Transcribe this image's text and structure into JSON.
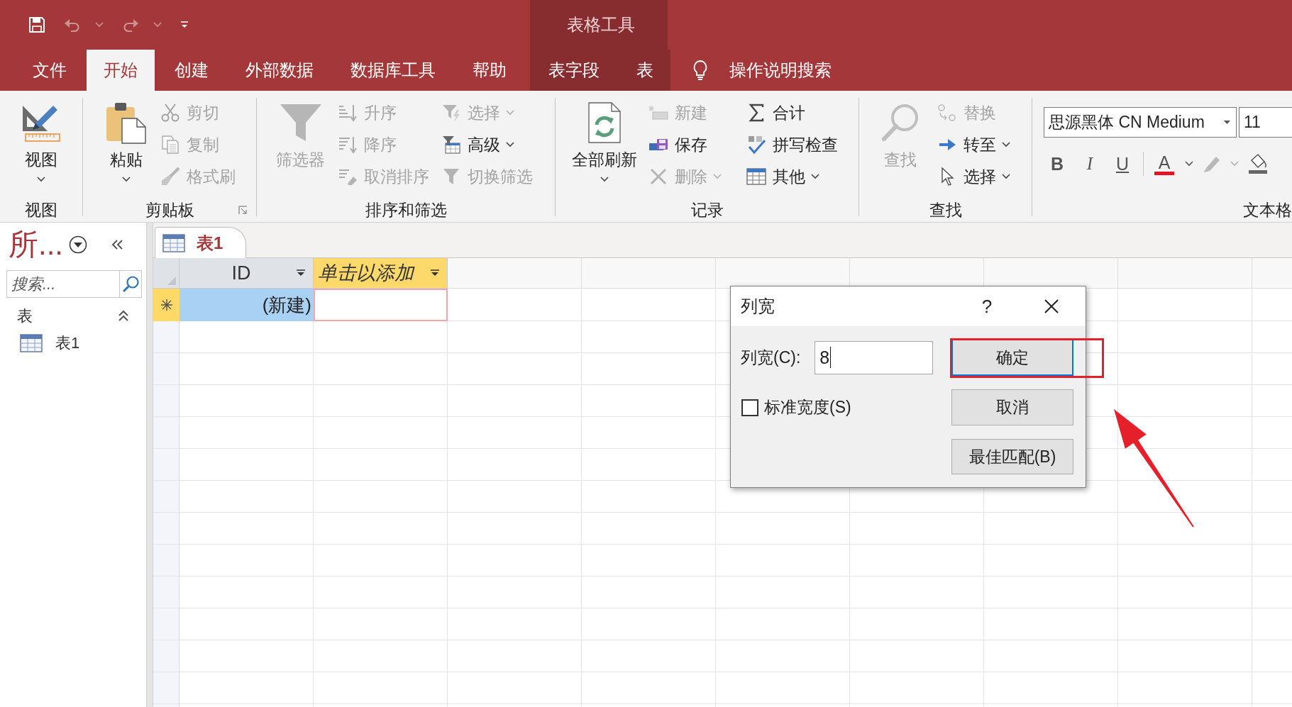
{
  "quick_access": [
    {
      "kind": "save",
      "disabled": false,
      "dropdown": false
    },
    {
      "kind": "undo",
      "disabled": true,
      "dropdown": true
    },
    {
      "kind": "redo",
      "disabled": true,
      "dropdown": true
    },
    {
      "kind": "customize",
      "disabled": false,
      "dropdown": false
    }
  ],
  "context_title": "表格工具",
  "ribbon_tabs": [
    {
      "label": "文件",
      "selected": false,
      "context": false
    },
    {
      "label": "开始",
      "selected": true,
      "context": false
    },
    {
      "label": "创建",
      "selected": false,
      "context": false
    },
    {
      "label": "外部数据",
      "selected": false,
      "context": false
    },
    {
      "label": "数据库工具",
      "selected": false,
      "context": false
    },
    {
      "label": "帮助",
      "selected": false,
      "context": false
    },
    {
      "label": "表字段",
      "selected": false,
      "context": true
    },
    {
      "label": "表",
      "selected": false,
      "context": true
    }
  ],
  "tell_me": {
    "label": "操作说明搜索"
  },
  "ribbon": {
    "groups": [
      {
        "kind": "commands",
        "label": "视图",
        "launcher": false,
        "columns": [
          [
            {
              "kind": "large",
              "label": "视图",
              "disabled": false,
              "dropdown": true
            }
          ]
        ]
      },
      {
        "kind": "commands",
        "label": "剪贴板",
        "launcher": true,
        "columns": [
          [
            {
              "kind": "large",
              "label": "粘贴",
              "disabled": false,
              "dropdown": true
            }
          ],
          [
            {
              "kind": "small",
              "label": "剪切",
              "disabled": true,
              "dropdown": false
            },
            {
              "kind": "small",
              "label": "复制",
              "disabled": true,
              "dropdown": false
            },
            {
              "kind": "small",
              "label": "格式刷",
              "disabled": true,
              "dropdown": false
            }
          ]
        ]
      },
      {
        "kind": "commands",
        "label": "排序和筛选",
        "launcher": false,
        "columns": [
          [
            {
              "kind": "large",
              "label": "筛选器",
              "disabled": true,
              "dropdown": false
            }
          ],
          [
            {
              "kind": "small",
              "label": "升序",
              "disabled": true,
              "dropdown": false
            },
            {
              "kind": "small",
              "label": "降序",
              "disabled": true,
              "dropdown": false
            },
            {
              "kind": "small",
              "label": "取消排序",
              "disabled": true,
              "dropdown": false
            }
          ],
          [
            {
              "kind": "small",
              "label": "选择",
              "disabled": true,
              "dropdown": true
            },
            {
              "kind": "small",
              "label": "高级",
              "disabled": false,
              "dropdown": true
            },
            {
              "kind": "small",
              "label": "切换筛选",
              "disabled": true,
              "dropdown": false
            }
          ]
        ]
      },
      {
        "kind": "commands",
        "label": "记录",
        "launcher": false,
        "columns": [
          [
            {
              "kind": "large",
              "label": "全部刷新",
              "disabled": false,
              "dropdown": true
            }
          ],
          [
            {
              "kind": "small",
              "label": "新建",
              "disabled": true,
              "dropdown": false
            },
            {
              "kind": "small",
              "label": "保存",
              "disabled": false,
              "dropdown": false
            },
            {
              "kind": "small",
              "label": "删除",
              "disabled": true,
              "dropdown": true
            }
          ],
          [
            {
              "kind": "small",
              "label": "合计",
              "disabled": false,
              "dropdown": false
            },
            {
              "kind": "small",
              "label": "拼写检查",
              "disabled": false,
              "dropdown": false
            },
            {
              "kind": "small",
              "label": "其他",
              "disabled": false,
              "dropdown": true
            }
          ]
        ]
      },
      {
        "kind": "commands",
        "label": "查找",
        "launcher": false,
        "columns": [
          [
            {
              "kind": "large",
              "label": "查找",
              "disabled": true,
              "dropdown": false
            }
          ],
          [
            {
              "kind": "small",
              "label": "替换",
              "disabled": true,
              "dropdown": false
            },
            {
              "kind": "small",
              "label": "转至",
              "disabled": false,
              "dropdown": true
            },
            {
              "kind": "small",
              "label": "选择",
              "disabled": false,
              "dropdown": true
            }
          ]
        ]
      },
      {
        "kind": "font",
        "label": "文本格",
        "launcher": false,
        "font_name": "思源黑体 CN Medium",
        "font_size": "11",
        "format_buttons": [
          {
            "kind": "bold",
            "label": "B",
            "disabled": false,
            "dropdown": false
          },
          {
            "kind": "italic",
            "label": "I",
            "disabled": false,
            "dropdown": false
          },
          {
            "kind": "underline",
            "label": "U",
            "disabled": false,
            "dropdown": false
          },
          {
            "kind": "font_color",
            "label": "A",
            "disabled": false,
            "dropdown": true
          },
          {
            "kind": "highlight",
            "disabled": true,
            "dropdown": true
          },
          {
            "kind": "fill",
            "disabled": false,
            "dropdown": false
          }
        ]
      }
    ]
  },
  "navigation": {
    "title": "所...",
    "search": {
      "placeholder": "搜索..."
    },
    "sections": [
      {
        "label": "表",
        "expanded": true,
        "items": [
          {
            "label": "表1",
            "selected": false
          }
        ]
      }
    ]
  },
  "document_tabs": [
    {
      "label": "表1",
      "selected": true
    }
  ],
  "datasheet": {
    "columns": [
      {
        "label": "ID",
        "kind": "field"
      },
      {
        "label": "单击以添加",
        "kind": "add"
      }
    ],
    "new_row": {
      "cells": [
        "(新建)"
      ]
    }
  },
  "dialog": {
    "title": "列宽",
    "help": "?",
    "width_field": {
      "label": "列宽(C):",
      "value": "8"
    },
    "standard_width": {
      "label": "标准宽度(S)",
      "checked": false
    },
    "buttons": [
      {
        "label": "确定",
        "default": true
      },
      {
        "label": "取消",
        "default": false
      },
      {
        "label": "最佳匹配(B)",
        "default": false
      }
    ]
  },
  "annotations": [
    {
      "kind": "box"
    },
    {
      "kind": "arrow"
    }
  ]
}
